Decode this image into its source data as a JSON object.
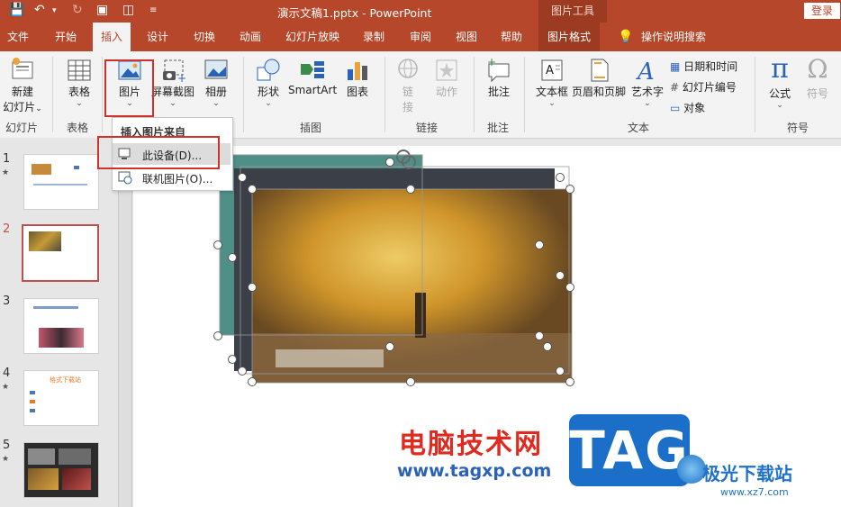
{
  "titlebar": {
    "doc_title": "演示文稿1.pptx  -  PowerPoint",
    "tools_title": "图片工具",
    "login": "登录"
  },
  "tabs": {
    "file": "文件",
    "home": "开始",
    "insert": "插入",
    "design": "设计",
    "transitions": "切换",
    "animations": "动画",
    "slideshow": "幻灯片放映",
    "record": "录制",
    "review": "审阅",
    "view": "视图",
    "help": "帮助",
    "picture_format": "图片格式",
    "tell_me": "操作说明搜索"
  },
  "ribbon": {
    "new_slide": "新建",
    "new_slide2": "幻灯片",
    "table": "表格",
    "pictures": "图片",
    "screenshot": "屏幕截图",
    "album": "相册",
    "shapes": "形状",
    "smartart": "SmartArt",
    "chart": "图表",
    "link": "链",
    "link2": "接",
    "action": "动作",
    "comment": "批注",
    "textbox": "文本框",
    "header_footer": "页眉和页脚",
    "wordart": "艺术字",
    "date_time": "日期和时间",
    "slide_number": "幻灯片编号",
    "object": "对象",
    "equation": "公式",
    "symbol": "符号",
    "groups": {
      "slides": "幻灯片",
      "tables": "表格",
      "illustrations": "插图",
      "links": "链接",
      "comments": "批注",
      "text": "文本",
      "symbols": "符号"
    }
  },
  "dropdown": {
    "header": "插入图片来自",
    "this_device": "此设备(D)...",
    "online": "联机图片(O)..."
  },
  "thumbnails": {
    "n1": "1",
    "n2": "2",
    "n3": "3",
    "n4": "4",
    "n5": "5",
    "slide4_title": "格式下载站"
  },
  "watermark": {
    "cn": "电脑技术网",
    "url": "www.tagxp.com",
    "tag": "TAG",
    "site": "极光下载站",
    "site_url": "www.xz7.com"
  },
  "colors": {
    "accent": "#b7472a",
    "highlight_box": "#d0312d",
    "tag_blue": "#1b6fc9"
  }
}
